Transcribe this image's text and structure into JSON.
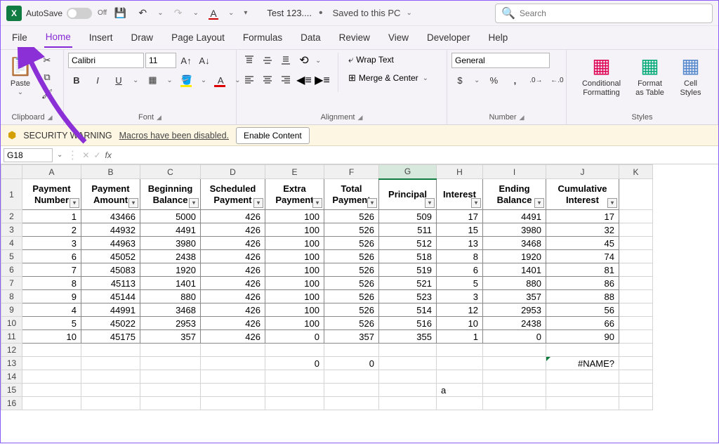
{
  "titlebar": {
    "autosave_label": "AutoSave",
    "autosave_state": "Off",
    "doc_name": "Test 123....",
    "save_status": "Saved to this PC",
    "search_placeholder": "Search"
  },
  "menu": {
    "tabs": [
      "File",
      "Home",
      "Insert",
      "Draw",
      "Page Layout",
      "Formulas",
      "Data",
      "Review",
      "View",
      "Developer",
      "Help"
    ],
    "active": "Home"
  },
  "ribbon": {
    "clipboard": {
      "paste": "Paste",
      "label": "Clipboard"
    },
    "font": {
      "name": "Calibri",
      "size": "11",
      "label": "Font",
      "bold": "B",
      "italic": "I",
      "underline": "U"
    },
    "alignment": {
      "wrap": "Wrap Text",
      "merge": "Merge & Center",
      "label": "Alignment"
    },
    "number": {
      "format": "General",
      "label": "Number"
    },
    "styles": {
      "cond": "Conditional Formatting",
      "table": "Format as Table",
      "cell": "Cell Styles",
      "label": "Styles"
    }
  },
  "security": {
    "title": "SECURITY WARNING",
    "msg": "Macros have been disabled.",
    "btn": "Enable Content"
  },
  "namebox": "G18",
  "columns": [
    "A",
    "B",
    "C",
    "D",
    "E",
    "F",
    "G",
    "H",
    "I",
    "J",
    "K"
  ],
  "headers": [
    "Payment Number",
    "Payment Amount",
    "Beginning Balance",
    "Scheduled Payment",
    "Extra Payment",
    "Total Payment",
    "Principal",
    "Interest",
    "Ending Balance",
    "Cumulative Interest"
  ],
  "rows": [
    {
      "n": "2",
      "d": [
        "1",
        "43466",
        "5000",
        "426",
        "100",
        "526",
        "509",
        "17",
        "4491",
        "17"
      ]
    },
    {
      "n": "3",
      "d": [
        "2",
        "44932",
        "4491",
        "426",
        "100",
        "526",
        "511",
        "15",
        "3980",
        "32"
      ]
    },
    {
      "n": "4",
      "d": [
        "3",
        "44963",
        "3980",
        "426",
        "100",
        "526",
        "512",
        "13",
        "3468",
        "45"
      ]
    },
    {
      "n": "5",
      "d": [
        "6",
        "45052",
        "2438",
        "426",
        "100",
        "526",
        "518",
        "8",
        "1920",
        "74"
      ]
    },
    {
      "n": "6",
      "d": [
        "7",
        "45083",
        "1920",
        "426",
        "100",
        "526",
        "519",
        "6",
        "1401",
        "81"
      ]
    },
    {
      "n": "7",
      "d": [
        "8",
        "45113",
        "1401",
        "426",
        "100",
        "526",
        "521",
        "5",
        "880",
        "86"
      ]
    },
    {
      "n": "8",
      "d": [
        "9",
        "45144",
        "880",
        "426",
        "100",
        "526",
        "523",
        "3",
        "357",
        "88"
      ]
    },
    {
      "n": "9",
      "d": [
        "4",
        "44991",
        "3468",
        "426",
        "100",
        "526",
        "514",
        "12",
        "2953",
        "56"
      ]
    },
    {
      "n": "10",
      "d": [
        "5",
        "45022",
        "2953",
        "426",
        "100",
        "526",
        "516",
        "10",
        "2438",
        "66"
      ]
    },
    {
      "n": "11",
      "d": [
        "10",
        "45175",
        "357",
        "426",
        "0",
        "357",
        "355",
        "1",
        "0",
        "90"
      ]
    }
  ],
  "row13": {
    "n": "13",
    "e": "0",
    "f": "0",
    "j": "#NAME?"
  },
  "row15": {
    "n": "15",
    "h": "a"
  },
  "empty_rows": [
    "12",
    "14",
    "16"
  ]
}
